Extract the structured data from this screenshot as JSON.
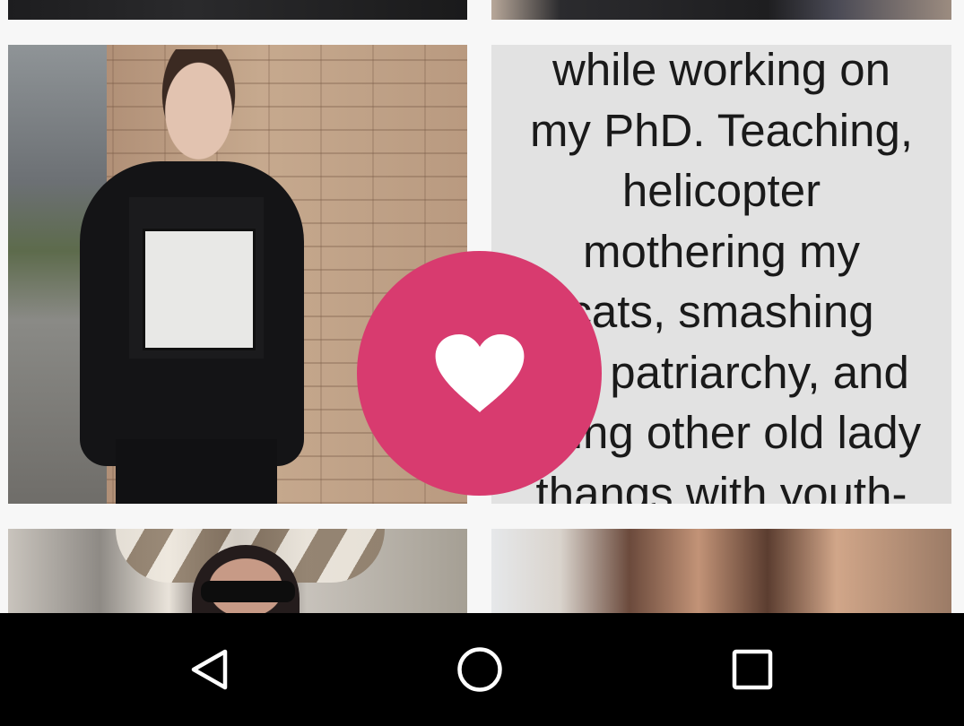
{
  "grid": {
    "bio_tile": {
      "text": "while working on\nmy PhD. Teaching,\nhelicopter\nmothering my\ncats, smashing\nthe patriarchy, and\ndoing other old lady\nthangs with youth-"
    },
    "photo_tiles": [
      {
        "position": "top-left",
        "icon": "photo"
      },
      {
        "position": "top-right",
        "icon": "photo"
      },
      {
        "position": "middle-left",
        "icon": "photo"
      },
      {
        "position": "bottom-left",
        "icon": "photo"
      },
      {
        "position": "bottom-right",
        "icon": "photo"
      }
    ]
  },
  "like_button": {
    "icon": "heart-icon",
    "color": "#d83b6f",
    "icon_color": "#ffffff"
  },
  "nav_bar": {
    "items": [
      {
        "name": "back",
        "icon": "triangle-back-icon"
      },
      {
        "name": "home",
        "icon": "circle-home-icon"
      },
      {
        "name": "recents",
        "icon": "square-recents-icon"
      }
    ],
    "background": "#000000"
  }
}
